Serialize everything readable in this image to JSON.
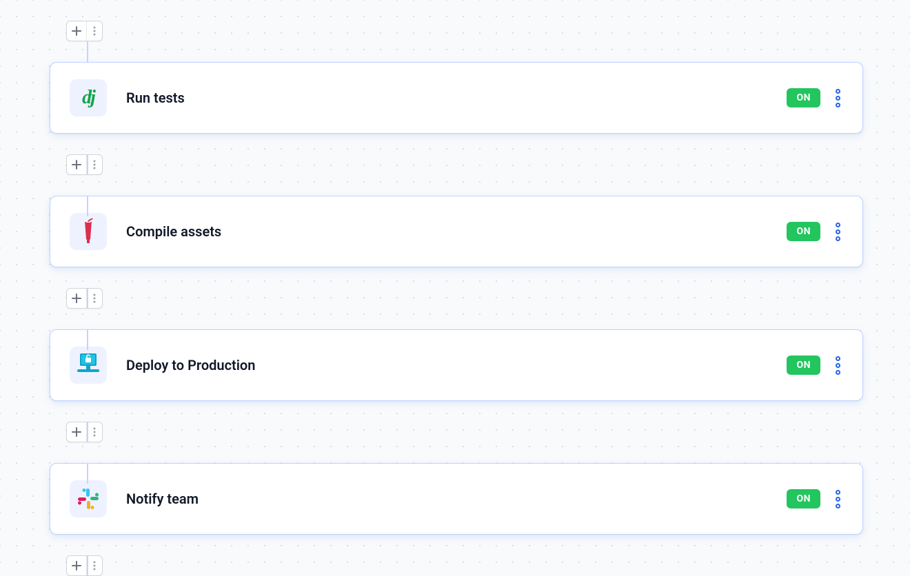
{
  "toggle_label": "ON",
  "steps": [
    {
      "title": "Run tests",
      "icon": "django-icon",
      "enabled": true
    },
    {
      "title": "Compile assets",
      "icon": "gulp-icon",
      "enabled": true
    },
    {
      "title": "Deploy to Production",
      "icon": "deploy-icon",
      "enabled": true
    },
    {
      "title": "Notify team",
      "icon": "slack-icon",
      "enabled": true
    }
  ]
}
